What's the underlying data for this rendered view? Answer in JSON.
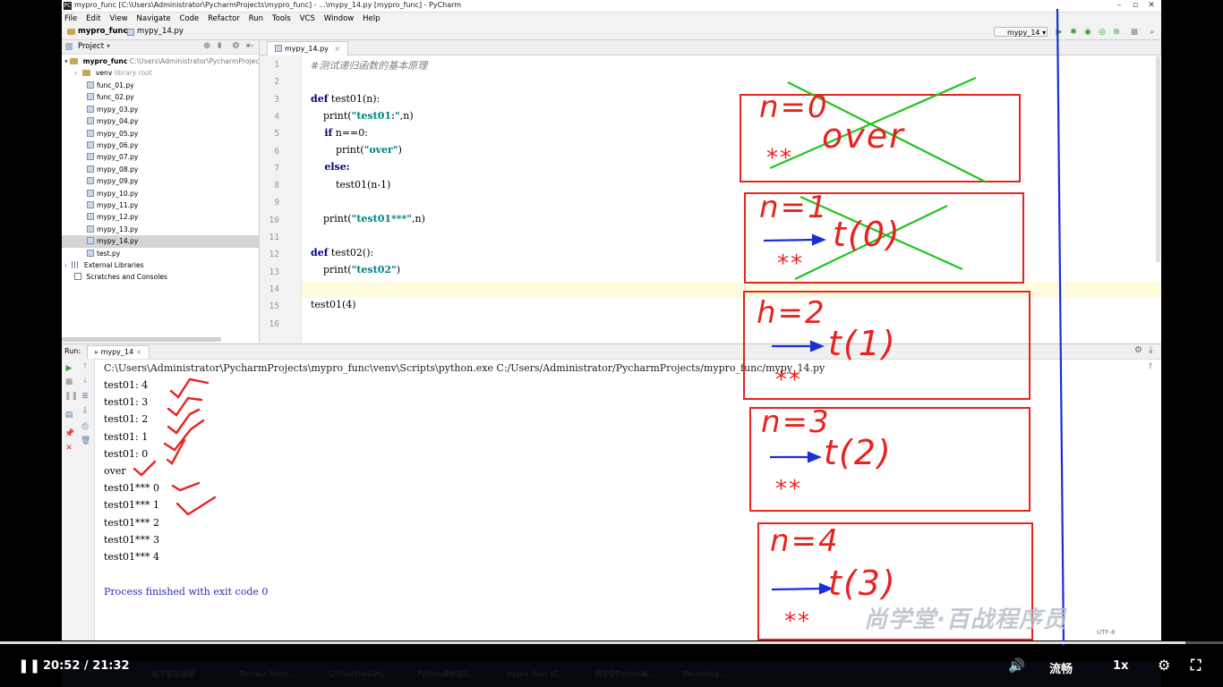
{
  "window": {
    "title": "mypro_func [C:\\Users\\Administrator\\PycharmProjects\\mypro_func] - ...\\mypy_14.py [mypro_func] - PyCharm"
  },
  "menu": [
    "File",
    "Edit",
    "View",
    "Navigate",
    "Code",
    "Refactor",
    "Run",
    "Tools",
    "VCS",
    "Window",
    "Help"
  ],
  "breadcrumb": {
    "project": "mypro_func",
    "file": "mypy_14.py"
  },
  "run_config": "mypy_14",
  "project_panel": {
    "header": "Project",
    "root": "mypro_func",
    "root_path": "C:\\Users\\Administrator\\PycharmProject",
    "venv": "venv",
    "venv_note": "library root",
    "files": [
      "func_01.py",
      "func_02.py",
      "mypy_03.py",
      "mypy_04.py",
      "mypy_05.py",
      "mypy_06.py",
      "mypy_07.py",
      "mypy_08.py",
      "mypy_09.py",
      "mypy_10.py",
      "mypy_11.py",
      "mypy_12.py",
      "mypy_13.py",
      "mypy_14.py",
      "test.py"
    ],
    "selected": "mypy_14.py",
    "external": "External Libraries",
    "scratches": "Scratches and Consoles"
  },
  "editor": {
    "tab": "mypy_14.py",
    "line_numbers": [
      "1",
      "2",
      "3",
      "4",
      "5",
      "6",
      "7",
      "8",
      "9",
      "10",
      "11",
      "12",
      "13",
      "14",
      "15",
      "16"
    ],
    "current_line": 14,
    "lines": {
      "l1_comment": "#测试递归函数的基本原理",
      "l3_def": "def",
      "l3_rest": " test01(n):",
      "l4_a": "    print(",
      "l4_str": "\"test01:\"",
      "l4_b": ",n)",
      "l5_if": "    if",
      "l5_rest": " n==0:",
      "l6_a": "        print(",
      "l6_str": "\"over\"",
      "l6_b": ")",
      "l7_else": "    else:",
      "l8": "        test01(n-1)",
      "l10_a": "    print(",
      "l10_str": "\"test01***\"",
      "l10_b": ",n)",
      "l12_def": "def",
      "l12_rest": " test02():",
      "l13_a": "    print(",
      "l13_str": "\"test02\"",
      "l13_b": ")",
      "l15": "test01(4)"
    }
  },
  "run_panel": {
    "label": "Run:",
    "tab": "mypy_14",
    "command": "C:\\Users\\Administrator\\PycharmProjects\\mypro_func\\venv\\Scripts\\python.exe C:/Users/Administrator/PycharmProjects/mypro_func/mypy_14.py",
    "output": [
      "test01: 4",
      "test01: 3",
      "test01: 2",
      "test01: 1",
      "test01: 0",
      "over",
      "test01*** 0",
      "test01*** 1",
      "test01*** 2",
      "test01*** 3",
      "test01*** 4"
    ],
    "exit_message": "Process finished with exit code 0"
  },
  "annotations": {
    "frames": [
      {
        "n": "n=0",
        "call": "over",
        "stars": "**"
      },
      {
        "n": "n=1",
        "call": "t(0)",
        "stars": "**"
      },
      {
        "n": "h=2",
        "call": "t(1)",
        "stars": "**"
      },
      {
        "n": "n=3",
        "call": "t(2)",
        "stars": "**"
      },
      {
        "n": "n=4",
        "call": "t(3)",
        "stars": "**"
      }
    ]
  },
  "watermark": "尚学堂·百战程序员",
  "status_encoding": "UTF-8",
  "taskbar": [
    "尚学堂在线网",
    "Process finish...",
    "C:\\UserData\\My...",
    "Python课件和C...",
    "mypro_func [C...",
    "尚学堂Python编...",
    "Recording..."
  ],
  "player": {
    "time_current": "20:52",
    "time_total": "21:32",
    "progress": 0.969,
    "quality": "流畅",
    "speed": "1x"
  },
  "colors": {
    "annotation_red": "#e8231f",
    "annotation_green": "#22c41f",
    "annotation_blue": "#1a2fd6"
  }
}
